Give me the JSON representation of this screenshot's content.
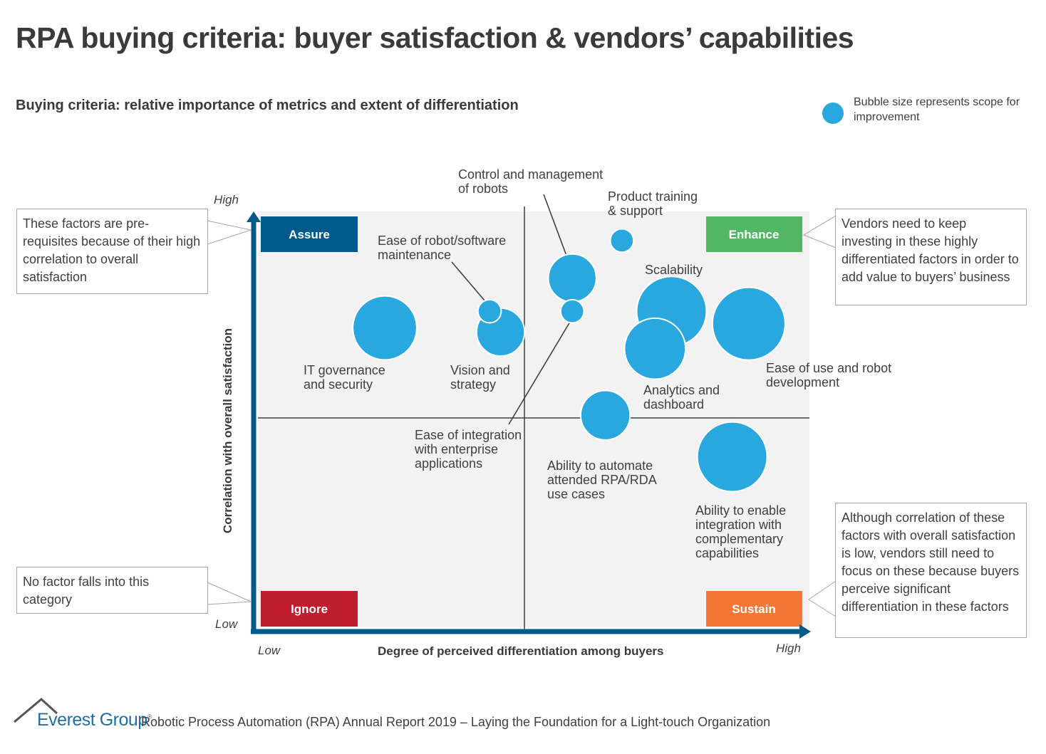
{
  "title": "RPA buying criteria: buyer satisfaction & vendors’ capabilities",
  "subtitle": "Buying criteria: relative importance of metrics and extent of differentiation",
  "legend": {
    "icon": "bubble-icon",
    "text": "Bubble size represents scope for improvement",
    "color": "#29a8e0"
  },
  "quadrants": {
    "assure": {
      "label": "Assure",
      "color": "#005a8c"
    },
    "enhance": {
      "label": "Enhance",
      "color": "#52b765"
    },
    "ignore": {
      "label": "Ignore",
      "color": "#be1e2d"
    },
    "sustain": {
      "label": "Sustain",
      "color": "#f47735"
    }
  },
  "callouts": {
    "assure": "These factors are pre-requisites because of their high correlation to overall satisfaction",
    "enhance": "Vendors need to keep investing in these highly differentiated factors in order to add value to buyers’ business",
    "ignore": "No factor falls into this category",
    "sustain": "Although correlation of these factors with overall satisfaction is low, vendors still need to focus on these because buyers perceive significant differentiation in these factors"
  },
  "axes": {
    "y_high": "High",
    "y_low": "Low",
    "x_low": "Low",
    "x_high": "High",
    "xlabel": "Degree of perceived differentiation among buyers",
    "ylabel": "Correlation with overall satisfaction"
  },
  "chart_data": {
    "type": "scatter",
    "title": "Buying criteria: relative importance of metrics and extent of differentiation",
    "xlabel": "Degree of perceived differentiation among buyers",
    "ylabel": "Correlation with overall satisfaction",
    "xlim": [
      0,
      100
    ],
    "ylim": [
      0,
      100
    ],
    "quadrant_split": {
      "x": 48,
      "y": 50
    },
    "size_meaning": "scope for improvement (relative)",
    "points": [
      {
        "name": "IT governance and security",
        "x": 23,
        "y": 72,
        "size": 0.88
      },
      {
        "name": "Ease of robot/software maintenance",
        "x": 42,
        "y": 76,
        "size": 0.32
      },
      {
        "name": "Vision and strategy",
        "x": 44,
        "y": 71,
        "size": 0.66
      },
      {
        "name": "Control and management of robots",
        "x": 57,
        "y": 84,
        "size": 0.66
      },
      {
        "name": "Ease of integration with enterprise applications",
        "x": 57,
        "y": 76,
        "size": 0.32
      },
      {
        "name": "Product training & support",
        "x": 66,
        "y": 93,
        "size": 0.32
      },
      {
        "name": "Scalability",
        "x": 75,
        "y": 76,
        "size": 0.96
      },
      {
        "name": "Analytics and dashboard",
        "x": 72,
        "y": 67,
        "size": 0.84
      },
      {
        "name": "Ease of use and robot development",
        "x": 89,
        "y": 73,
        "size": 1.0
      },
      {
        "name": "Ability to automate attended RPA/RDA use cases",
        "x": 63,
        "y": 51,
        "size": 0.68
      },
      {
        "name": "Ability to enable integration with complementary capabilities",
        "x": 86,
        "y": 41,
        "size": 0.96
      }
    ],
    "labels": {
      "it_gov": [
        "IT governance",
        "and security"
      ],
      "maint": [
        "Ease of robot/software",
        "maintenance"
      ],
      "vision": [
        "Vision and",
        "strategy"
      ],
      "control": [
        "Control and management",
        "of robots"
      ],
      "integ": [
        "Ease of integration",
        "with enterprise",
        "applications"
      ],
      "training": [
        "Product training",
        "& support"
      ],
      "scal": [
        "Scalability"
      ],
      "analytics": [
        "Analytics and",
        "dashboard"
      ],
      "ease": [
        "Ease of use and robot",
        "development"
      ],
      "attended": [
        "Ability to automate",
        "attended RPA/RDA",
        "use cases"
      ],
      "complement": [
        "Ability to enable",
        "integration with",
        "complementary",
        "capabilities"
      ]
    }
  },
  "footer": {
    "brand": "Everest Group",
    "registered": "®",
    "text": "Robotic Process Automation (RPA) Annual Report 2019 – Laying the Foundation for a Light-touch Organization"
  }
}
